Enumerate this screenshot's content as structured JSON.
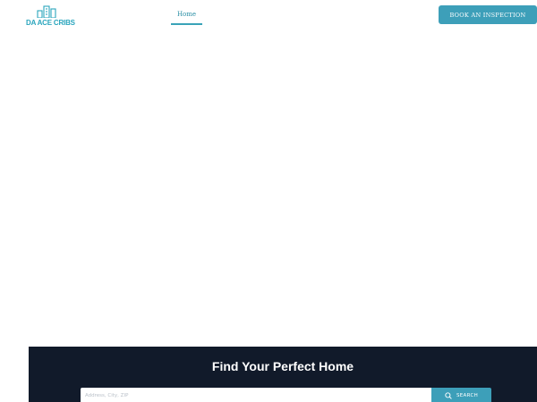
{
  "header": {
    "logo_text": "DA ACE CRIBS",
    "logo_icon": "buildings-icon",
    "nav": {
      "home_label": "Home"
    },
    "cta_label": "BOOK AN INSPECTION"
  },
  "search": {
    "title": "Find Your Perfect Home",
    "placeholder": "Address, City, ZIP",
    "button_label": "SEARCH",
    "button_icon": "search-icon"
  },
  "colors": {
    "accent": "#3d9fb9",
    "logo": "#2aa5bd",
    "search_panel_bg": "#111a2a",
    "background": "#ffffff"
  }
}
